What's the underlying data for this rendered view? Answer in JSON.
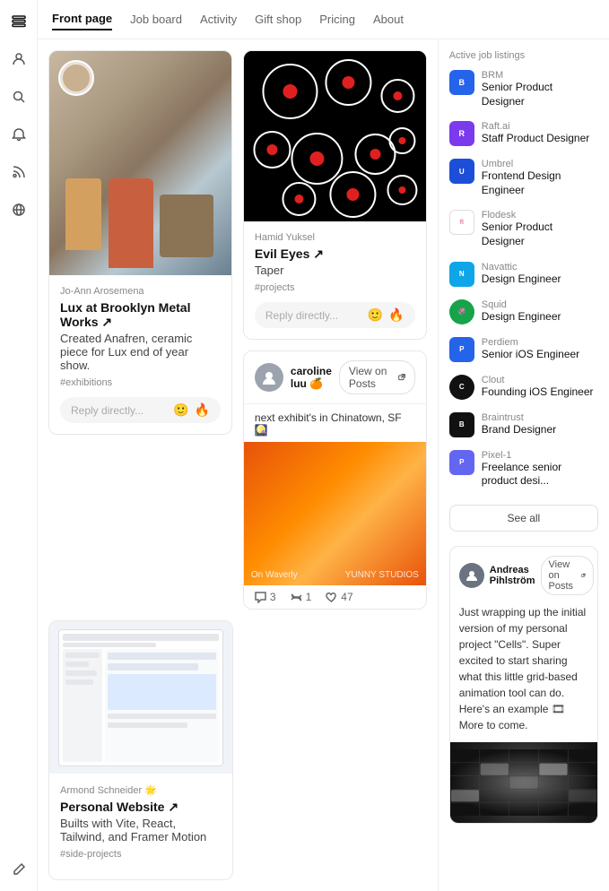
{
  "nav": {
    "items": [
      {
        "label": "Front page",
        "active": true
      },
      {
        "label": "Job board",
        "active": false
      },
      {
        "label": "Activity",
        "active": false
      },
      {
        "label": "Gift shop",
        "active": false
      },
      {
        "label": "Pricing",
        "active": false
      },
      {
        "label": "About",
        "active": false
      }
    ]
  },
  "sidebar_icons": [
    "list",
    "person",
    "search",
    "bell",
    "rss",
    "globe",
    "edit"
  ],
  "feed": {
    "card1": {
      "author": "Jo-Ann Arosemena",
      "title": "Lux at Brooklyn Metal Works ↗",
      "description": "Created Anafren, ceramic piece for Lux end of year show.",
      "tags": "#exhibitions",
      "reply_placeholder": "Reply directly..."
    },
    "card2": {
      "author": "Hamid Yuksel",
      "title": "Evil Eyes ↗",
      "subtitle": "Taper",
      "tags": "#projects",
      "reply_placeholder": "Reply directly..."
    },
    "card3": {
      "author": "caroline luu 🍊",
      "text": "next exhibit's in Chinatown, SF 🎑",
      "view_on_posts": "View on Posts",
      "actions": {
        "comments": "3",
        "repost": "1",
        "likes": "47"
      },
      "image_labels": {
        "left": "On Waverly",
        "right": "YUNNY STUDIOS"
      }
    },
    "card4": {
      "author": "Armond Schneider 🌟",
      "title": "Personal Website ↗",
      "description": "Builts with Vite, React, Tailwind, and Framer Motion",
      "tags": "#side-projects"
    }
  },
  "right_sidebar": {
    "section_title": "Active job listings",
    "jobs": [
      {
        "company": "BRM",
        "title": "Senior Product Designer",
        "logo_class": "logo-brm"
      },
      {
        "company": "Raft.ai",
        "title": "Staff Product Designer",
        "logo_class": "logo-raft"
      },
      {
        "company": "Umbrel",
        "title": "Frontend Design Engineer",
        "logo_class": "logo-umbrel"
      },
      {
        "company": "Flodesk",
        "title": "Senior Product Designer",
        "logo_class": "logo-flodesk"
      },
      {
        "company": "Navattic",
        "title": "Design Engineer",
        "logo_class": "logo-navattic"
      },
      {
        "company": "Squid",
        "title": "Design Engineer",
        "logo_class": "logo-squid"
      },
      {
        "company": "Perdiem",
        "title": "Senior iOS Engineer",
        "logo_class": "logo-perdiem"
      },
      {
        "company": "Clout",
        "title": "Founding iOS Engineer",
        "logo_class": "logo-clout"
      },
      {
        "company": "Braintrust",
        "title": "Brand Designer",
        "logo_class": "logo-braintrust"
      },
      {
        "company": "Pixel-1",
        "title": "Freelance senior product desi...",
        "logo_class": "logo-pixel1"
      }
    ],
    "see_all": "See all",
    "sidebar_post": {
      "author": "Andreas Pihlström",
      "text": "Just wrapping up the initial version of my personal project \"Cells\". Super excited to start sharing what this little grid-based animation tool can do. Here's an example 🎞 More to come."
    }
  }
}
